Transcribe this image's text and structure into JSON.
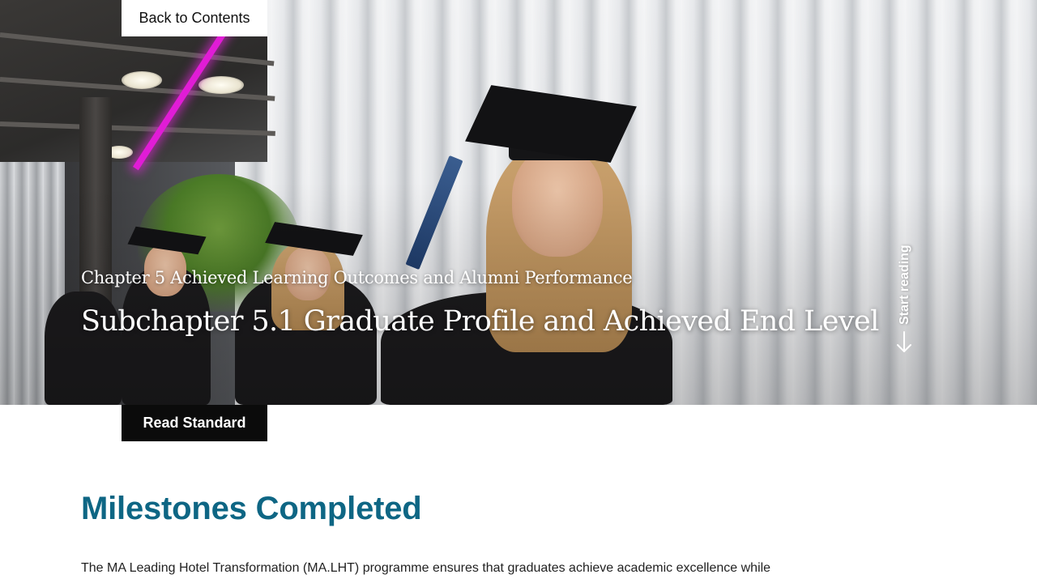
{
  "nav": {
    "back_label": "Back to Contents"
  },
  "hero": {
    "chapter_title": "Chapter 5 Achieved Learning Outcomes and Alumni Performance",
    "subchapter_title": "Subchapter 5.1 Graduate Profile and Achieved End Level",
    "start_reading_label": "Start reading",
    "start_reading_icon": "arrow-down-icon",
    "photo_subject": "graduates-in-caps-and-gowns-photo"
  },
  "actions": {
    "read_standard_label": "Read Standard"
  },
  "content": {
    "section_heading": "Milestones Completed",
    "intro_text": "The MA Leading Hotel Transformation (MA.LHT) programme ensures that graduates achieve academic excellence while"
  },
  "colors": {
    "heading_accent": "#0e6684",
    "button_dark": "#0b0b0b",
    "button_light": "#ffffff",
    "text_body": "#222222"
  }
}
